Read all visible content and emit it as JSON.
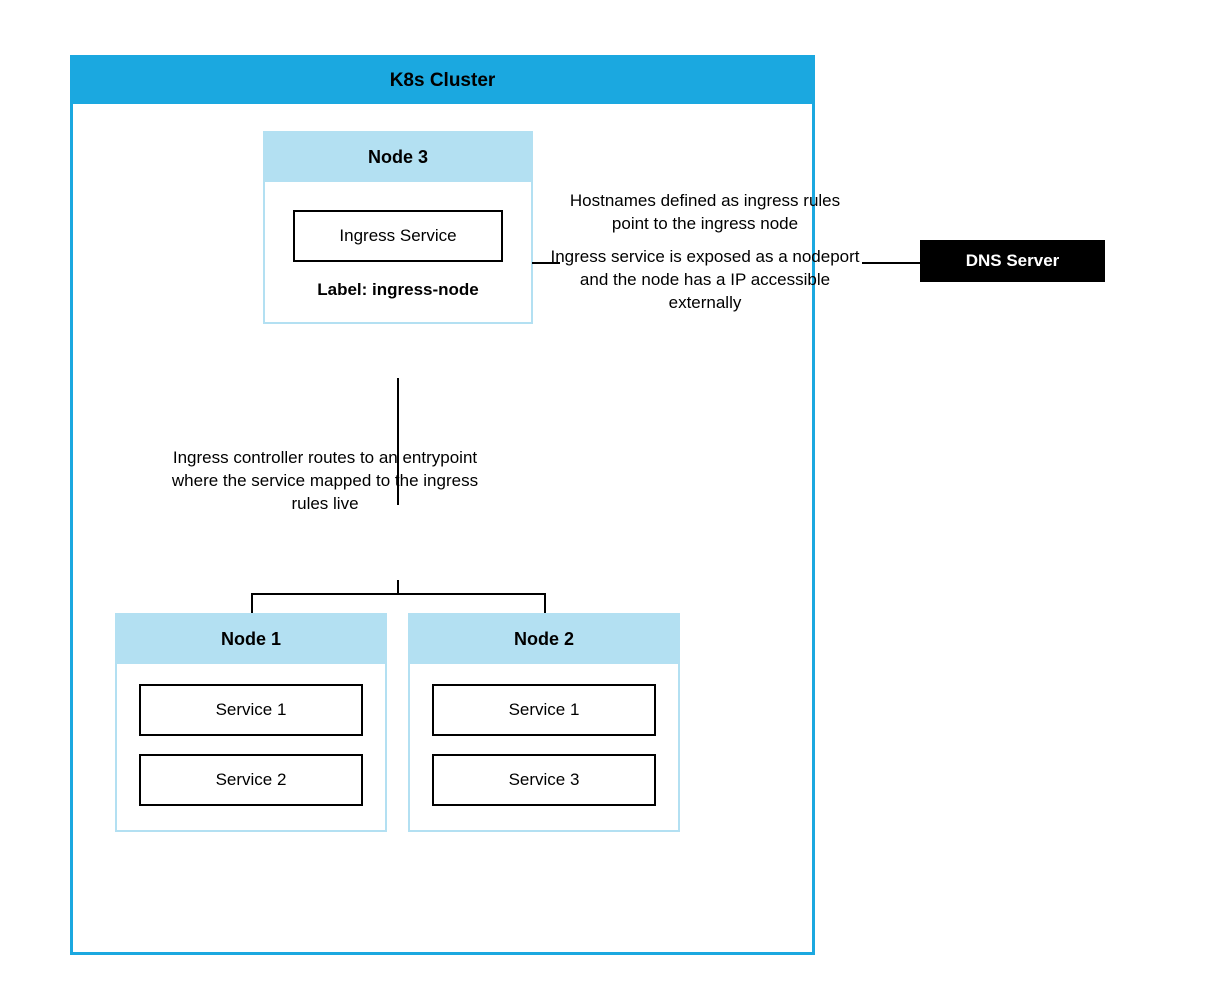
{
  "cluster": {
    "title": "K8s Cluster"
  },
  "node3": {
    "title": "Node 3",
    "service": "Ingress Service",
    "label": "Label: ingress-node"
  },
  "node1": {
    "title": "Node 1",
    "services": [
      "Service 1",
      "Service 2"
    ]
  },
  "node2": {
    "title": "Node 2",
    "services": [
      "Service 1",
      "Service 3"
    ]
  },
  "annotations": {
    "hostnames": "Hostnames defined as ingress rules point to the ingress node",
    "exposed": "Ingress service is exposed as a nodeport and the node has a IP accessible externally",
    "routes": "Ingress controller routes to an entrypoint where the service mapped to the ingress rules live"
  },
  "dns": {
    "label": "DNS Server"
  }
}
